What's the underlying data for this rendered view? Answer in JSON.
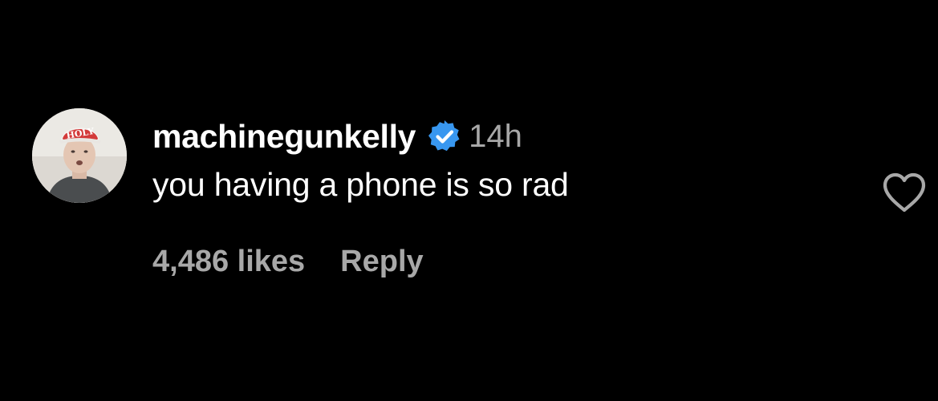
{
  "comment": {
    "avatar_icon": "user-avatar",
    "avatar_hat_text": "HOLY",
    "username": "machinegunkelly",
    "verified_icon": "verified-badge-icon",
    "timestamp": "14h",
    "text": "you having a phone is so rad",
    "likes": "4,486 likes",
    "reply_label": "Reply",
    "like_icon": "heart-outline-icon"
  },
  "colors": {
    "background": "#000000",
    "primary_text": "#ffffff",
    "secondary_text": "#a8a8a8",
    "verified_blue": "#3897f0"
  }
}
